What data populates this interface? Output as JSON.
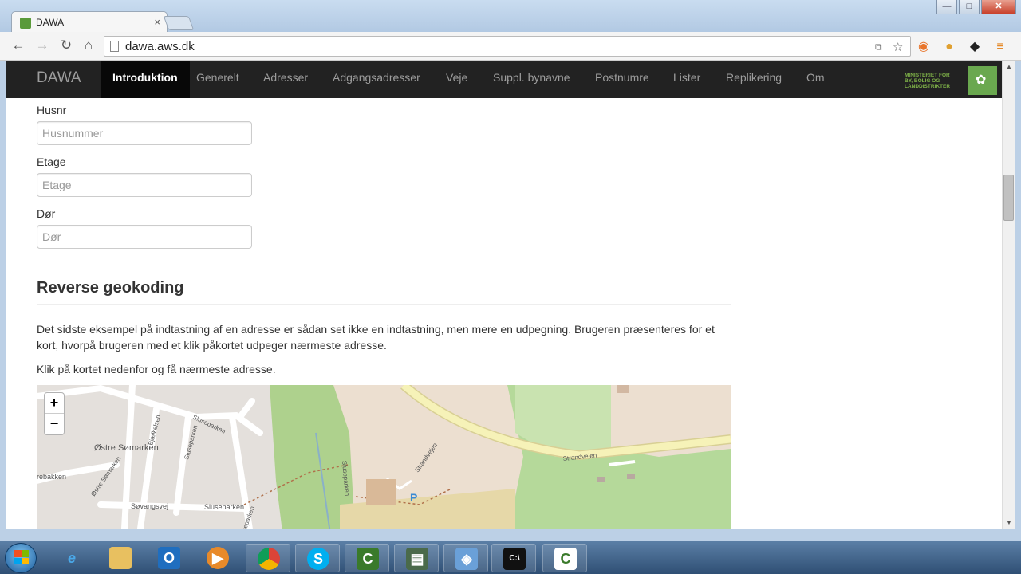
{
  "browser": {
    "tab_title": "DAWA",
    "url": "dawa.aws.dk",
    "tab_close_glyph": "×",
    "icons": [
      "back-arrow-icon",
      "forward-arrow-icon",
      "reload-icon",
      "home-icon",
      "page-icon",
      "translate-icon",
      "star-icon",
      "rss-icon",
      "extension-icon",
      "layers-icon",
      "menu-icon"
    ]
  },
  "navbar": {
    "brand": "DAWA",
    "items": [
      {
        "label": "Introduktion",
        "active": true
      },
      {
        "label": "Generelt"
      },
      {
        "label": "Adresser"
      },
      {
        "label": "Adgangsadresser"
      },
      {
        "label": "Veje"
      },
      {
        "label": "Suppl. bynavne"
      },
      {
        "label": "Postnumre"
      },
      {
        "label": "Lister"
      },
      {
        "label": "Replikering"
      },
      {
        "label": "Om"
      }
    ],
    "ministry_lines": [
      "MINISTERIET FOR",
      "BY, BOLIG OG",
      "LANDDISTRIKTER"
    ]
  },
  "form": {
    "husnr": {
      "label": "Husnr",
      "placeholder": "Husnummer"
    },
    "etage": {
      "label": "Etage",
      "placeholder": "Etage"
    },
    "doer": {
      "label": "Dør",
      "placeholder": "Dør"
    }
  },
  "section": {
    "heading": "Reverse geokoding",
    "paragraph1": "Det sidste eksempel på indtastning af en adresse er sådan set ikke en indtastning, men mere en udpegning. Brugeren præsenteres for et kort, hvorpå brugeren med et klik påkortet udpeger nærmeste adresse.",
    "paragraph2": "Klik på kortet nedenfor og få nærmeste adresse."
  },
  "map": {
    "zoom_in": "+",
    "zoom_out": "−",
    "street_labels": [
      "Østre Sømarken",
      "Bjælkelsen",
      "Sluseparken",
      "Sluseparken",
      "Sluseparken",
      "Sluseparken",
      "Østre Sømarken",
      "Søvangsvej",
      "rebakken",
      "Strandvejen",
      "Strandvejen",
      "Sluseparken"
    ],
    "parking": "P",
    "colors": {
      "land": "#e4e0dc",
      "forest": "#aed18d",
      "road_major": "#f6f0b0",
      "residential": "#ecdfd0",
      "building": "#d9b998"
    }
  },
  "taskbar": {
    "icons": [
      "windows-start-icon",
      "internet-explorer-icon",
      "file-explorer-icon",
      "outlook-icon",
      "media-player-icon",
      "chrome-icon",
      "skype-icon",
      "camtasia-icon",
      "network-icon",
      "virtualbox-icon",
      "cmd-icon",
      "camtasia-recorder-icon"
    ]
  }
}
